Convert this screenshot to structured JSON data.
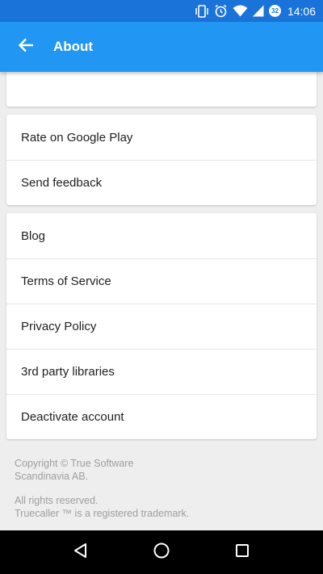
{
  "status_bar": {
    "time": "14:06",
    "battery_level": "32",
    "icons": [
      "vibrate-icon",
      "alarm-icon",
      "wifi-icon",
      "signal-icon",
      "battery-icon"
    ]
  },
  "app_bar": {
    "title": "About",
    "back_icon": "arrow-back-icon",
    "color": "#2196f3"
  },
  "feedback_card": {
    "items": [
      {
        "label": "Rate on Google Play"
      },
      {
        "label": "Send feedback"
      }
    ]
  },
  "links_card": {
    "items": [
      {
        "label": "Blog"
      },
      {
        "label": "Terms of Service"
      },
      {
        "label": "Privacy Policy"
      },
      {
        "label": "3rd party libraries"
      },
      {
        "label": "Deactivate account"
      }
    ]
  },
  "footer": {
    "copyright_line1": "Copyright © True Software",
    "copyright_line2": "Scandinavia AB.",
    "rights": "All rights reserved.",
    "trademark": "Truecaller ™ is a registered trademark."
  },
  "nav_bar": {
    "icons": [
      "back-triangle-icon",
      "home-circle-icon",
      "recents-square-icon"
    ]
  }
}
